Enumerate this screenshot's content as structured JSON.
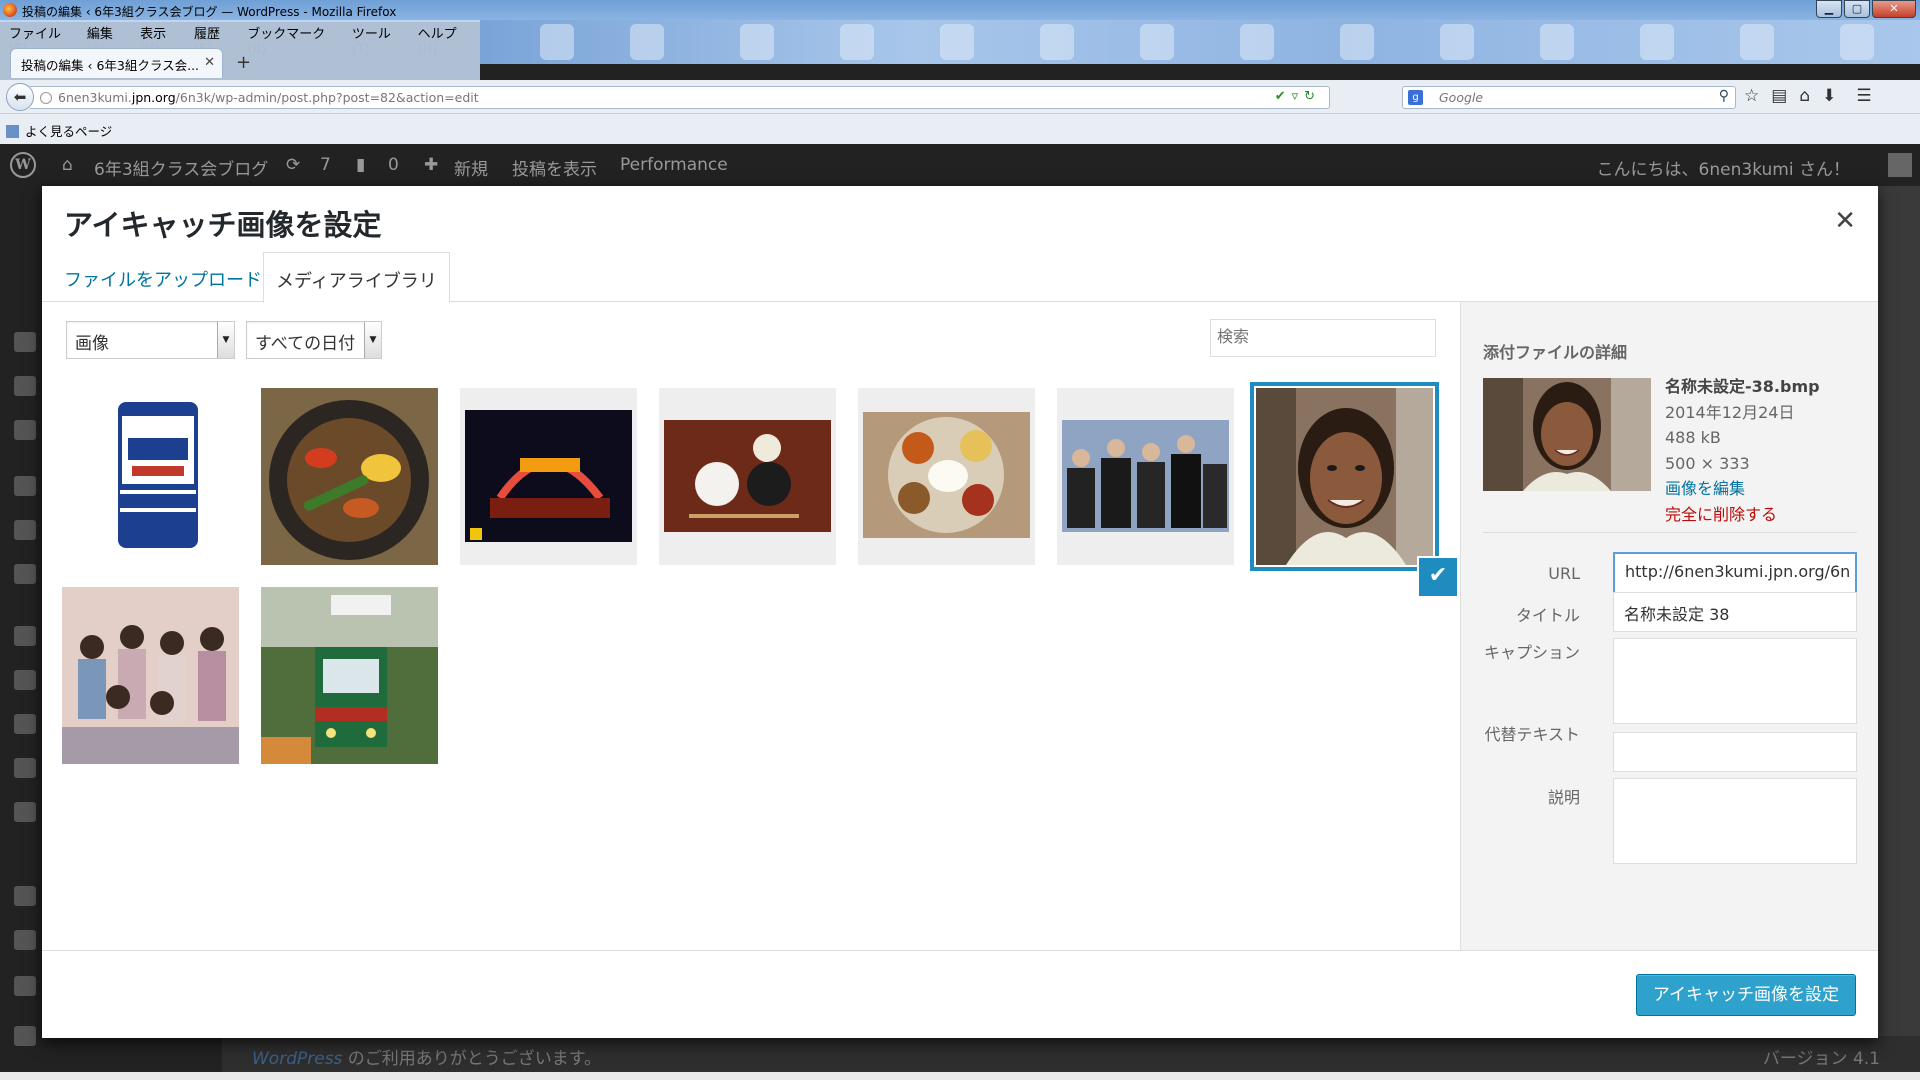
{
  "browser": {
    "window_title": "投稿の編集 ‹ 6年3組クラス会ブログ — WordPress - Mozilla Firefox",
    "menu": [
      "ファイル(F)",
      "編集(E)",
      "表示(V)",
      "履歴(S)",
      "ブックマーク(B)",
      "ツール(T)",
      "ヘルプ(H)"
    ],
    "tab_title": "投稿の編集 ‹ 6年3組クラス会...",
    "url_prefix": "6nen3kumi.",
    "url_host": "jpn.org",
    "url_path": "/6n3k/wp-admin/post.php?post=82&action=edit",
    "search_placeholder": "Google",
    "bookmark": "よく見るページ"
  },
  "adminbar": {
    "site_name": "6年3組クラス会ブログ",
    "updates": "7",
    "comments": "0",
    "new": "新規",
    "view_post": "投稿を表示",
    "performance": "Performance",
    "greeting": "こんにちは、6nen3kumi さん！"
  },
  "footer": {
    "thanks_link": "WordPress",
    "thanks_text": " のご利用ありがとうございます。",
    "version": "バージョン 4.1"
  },
  "modal": {
    "title": "アイキャッチ画像を設定",
    "tabs": {
      "upload": "ファイルをアップロード",
      "library": "メディアライブラリ"
    },
    "filter_type": "画像",
    "filter_date": "すべての日付",
    "search_placeholder": "検索",
    "details": {
      "heading": "添付ファイルの詳細",
      "filename": "名称未設定-38.bmp",
      "date": "2014年12月24日",
      "size": "488 kB",
      "dimensions": "500 × 333",
      "edit_link": "画像を編集",
      "delete_link": "完全に削除する",
      "url_label": "URL",
      "url_value": "http://6nen3kumi.jpn.org/6n",
      "title_label": "タイトル",
      "title_value": "名称未設定 38",
      "caption_label": "キャプション",
      "alt_label": "代替テキスト",
      "description_label": "説明"
    },
    "primary_button": "アイキャッチ画像を設定"
  },
  "thumb_colors": {
    "yogurt": "#1c3f8f",
    "curry": "#6b5a3a",
    "theater": "#c0392b",
    "meal": "#7a2e1a",
    "thali": "#c8a64a",
    "band": "#3b4a6b",
    "girl": "#8c6a4f",
    "group": "#d8b8b0",
    "train": "#2f6b3a"
  }
}
